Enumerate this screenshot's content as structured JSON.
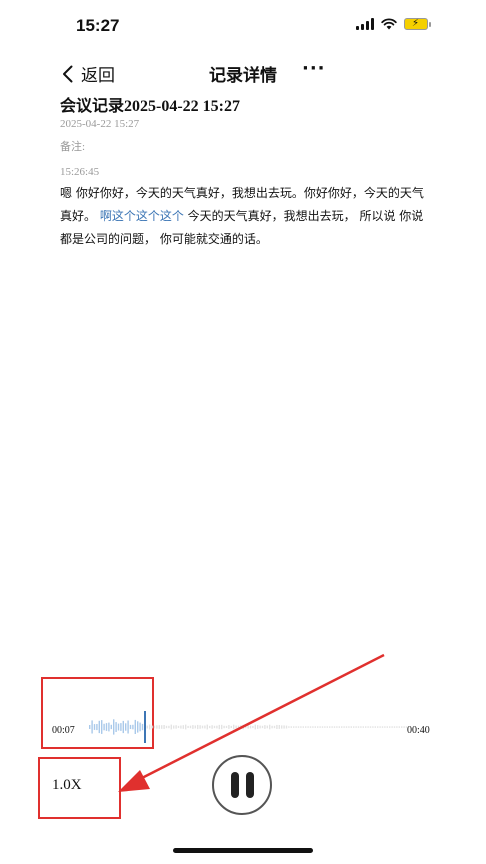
{
  "status": {
    "time": "15:27"
  },
  "nav": {
    "back_label": "返回",
    "title": "记录详情",
    "more": "···"
  },
  "record": {
    "title": "会议记录2025-04-22 15:27",
    "date": "2025-04-22 15:27",
    "note_label": "备注:",
    "segment_time": "15:26:45",
    "text_before": "嗯 你好你好，今天的天气真好，我想出去玩。你好你好，今天的天气真好。",
    "text_highlight": "啊这个这个这个",
    "text_after": " 今天的天气真好，我想出去玩， 所以说 你说都是公司的问题， 你可能就交通的话。"
  },
  "player": {
    "current_time": "00:07",
    "total_time": "00:40",
    "speed": "1.0X",
    "progress": 0.175
  },
  "colors": {
    "accent": "#3d76b5",
    "annotation": "#e0302e",
    "wave_played": "#a9c9ea",
    "wave_rest": "#e3e3e3"
  }
}
